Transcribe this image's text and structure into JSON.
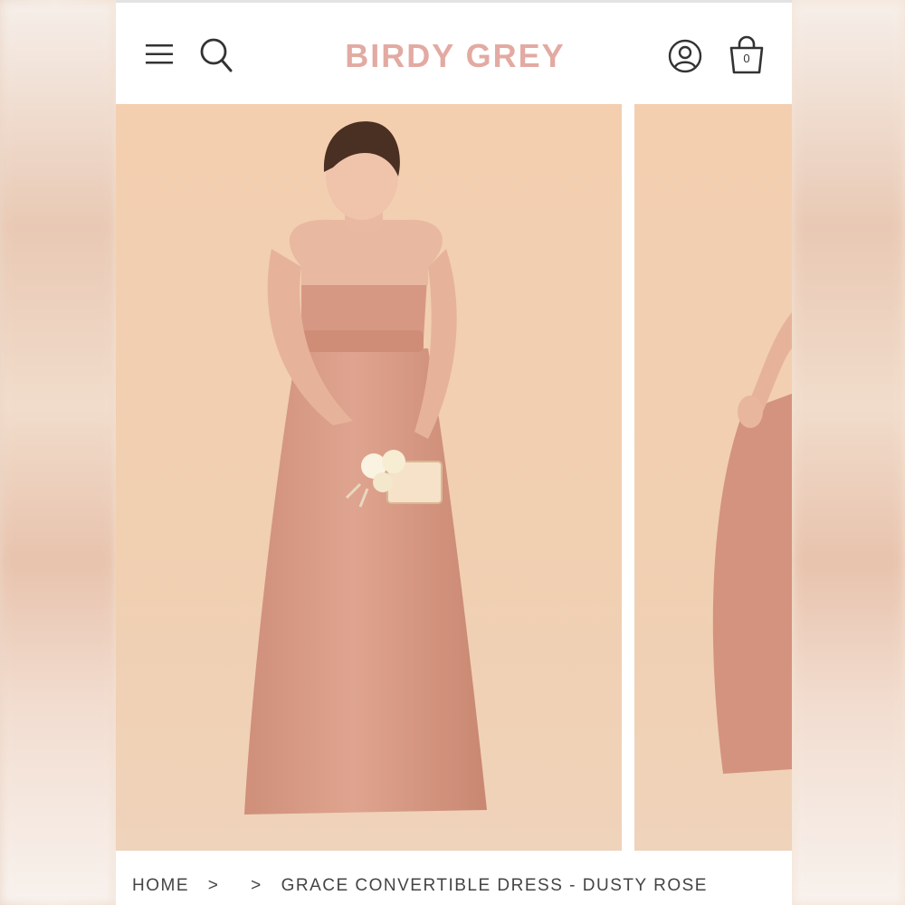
{
  "brand": {
    "logo_text": "BIRDY GREY",
    "accent_color": "#e2aaa2"
  },
  "header": {
    "icons": [
      "menu-icon",
      "search-icon",
      "account-icon",
      "shopping-bag-icon"
    ],
    "cart_count": "0"
  },
  "gallery": {
    "images": [
      {
        "subject": "woman wearing dusty rose strapless gown holding bouquet and clutch"
      },
      {
        "subject": "partially visible second photo of dusty rose gown"
      }
    ],
    "background_color": "#f2cfb0",
    "dress_color": "#d99a84"
  },
  "breadcrumb": {
    "items": [
      "HOME",
      "GRACE CONVERTIBLE DRESS - DUSTY ROSE"
    ],
    "separator": ">"
  }
}
